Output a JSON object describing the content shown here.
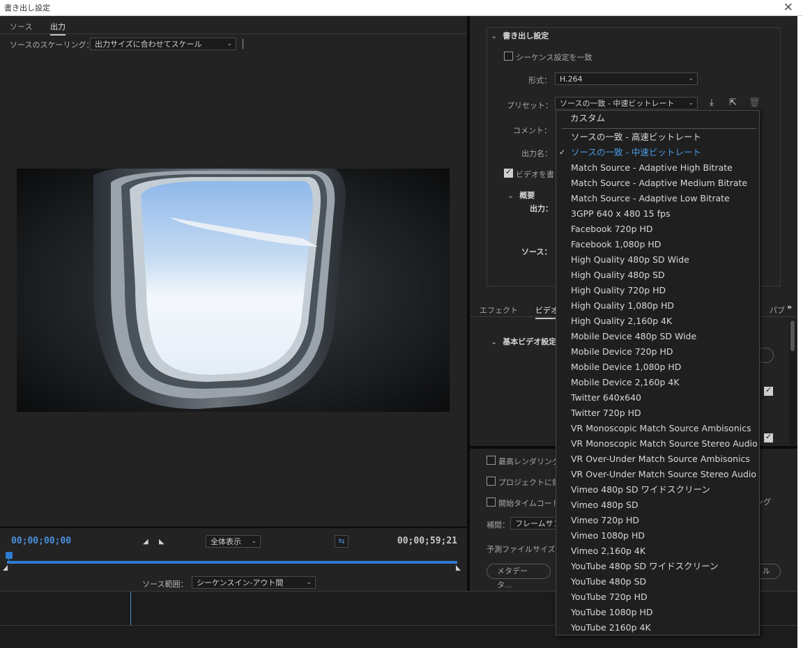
{
  "window": {
    "title": "書き出し設定"
  },
  "left_tabs": [
    "ソース",
    "出力"
  ],
  "source_scaling": {
    "label": "ソースのスケーリング：",
    "value": "出力サイズに合わせてスケール"
  },
  "playback": {
    "timecode_current": "00;00;00;00",
    "timecode_end": "00;00;59;21",
    "zoom": "全体表示",
    "source_range_label": "ソース範囲：",
    "source_range_value": "シーケンスイン-アウト間"
  },
  "export_settings": {
    "header": "書き出し設定",
    "match_sequence": "シーケンス設定を一致",
    "format_label": "形式：",
    "format_value": "H.264",
    "preset_label": "プリセット：",
    "preset_value": "ソースの一致 - 中速ビットレート",
    "comment_label": "コメント：",
    "output_name_label": "出力名：",
    "export_video": "ビデオを書き",
    "summary_header": "概要",
    "summary_output_label": "出力：",
    "summary_source_label": "ソース："
  },
  "right_tabs": [
    "エフェクト",
    "ビデオ",
    "パブ"
  ],
  "basic_video": {
    "header": "基本ビデオ設定"
  },
  "bottom_options": {
    "max_render": "最高レンダリング",
    "use_proxy": "プロジェクトに鉄",
    "start_timecode": "開始タイムコード",
    "interp_label": "補間：",
    "interp_value": "フレームサン",
    "est_size_label": "予測ファイルサイズ：",
    "metadata_btn": "メタデータ...",
    "ring_text": "ング",
    "right_btn_text": "ル"
  },
  "preset_menu": {
    "top_item": "カスタム",
    "items": [
      "ソースの一致 - 高速ビットレート",
      "ソースの一致 - 中速ビットレート",
      "Match Source - Adaptive High Bitrate",
      "Match Source - Adaptive Medium Bitrate",
      "Match Source - Adaptive Low Bitrate",
      "3GPP 640 x 480 15 fps",
      "Facebook 720p HD",
      "Facebook 1,080p HD",
      "High Quality 480p SD Wide",
      "High Quality 480p SD",
      "High Quality 720p HD",
      "High Quality 1,080p HD",
      "High Quality 2,160p 4K",
      "Mobile Device 480p SD Wide",
      "Mobile Device 720p HD",
      "Mobile Device 1,080p HD",
      "Mobile Device 2,160p 4K",
      "Twitter 640x640",
      "Twitter 720p HD",
      "VR Monoscopic Match Source Ambisonics",
      "VR Monoscopic Match Source Stereo Audio",
      "VR Over-Under Match Source Ambisonics",
      "VR Over-Under Match Source Stereo Audio",
      "Vimeo 480p SD ワイドスクリーン",
      "Vimeo 480p SD",
      "Vimeo 720p HD",
      "Vimeo 1080p HD",
      "Vimeo 2,160p 4K",
      "YouTube 480p SD ワイドスクリーン",
      "YouTube 480p SD",
      "YouTube 720p HD",
      "YouTube 1080p HD",
      "YouTube 2160p 4K"
    ],
    "selected_index": 1
  },
  "colors": {
    "accent": "#4a9ee8",
    "timeline": "#2d7bd0"
  }
}
